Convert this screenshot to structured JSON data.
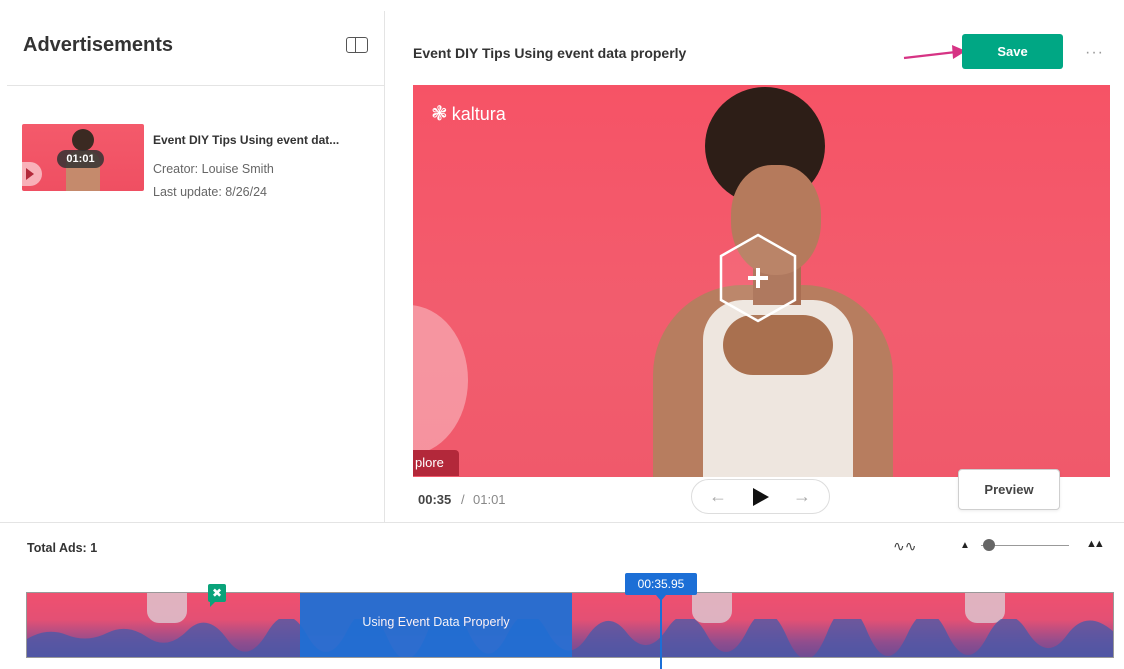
{
  "left_panel": {
    "title": "Advertisements",
    "layout_toggle_icon": "panel-layout-icon",
    "entries": [
      {
        "title": "Event DIY Tips Using event dat...",
        "creator": "Creator: Louise Smith",
        "last_update": "Last update: 8/26/24",
        "duration": "01:01"
      }
    ]
  },
  "editor": {
    "entry_title": "Event DIY Tips Using event data properly",
    "save_label": "Save",
    "more_icon": "more-horizontal-icon",
    "annotation_color": "#d63384",
    "save_color": "#00a784"
  },
  "player": {
    "brand": "kaltura",
    "overlay_chip": "plore",
    "current_time": "00:35",
    "separator": "/",
    "total_time": "01:01",
    "prev_icon": "arrow-left-icon",
    "play_icon": "play-icon",
    "next_icon": "arrow-right-icon",
    "hotspot_icon": "hexagon-plus-icon",
    "preview_label": "Preview"
  },
  "timeline": {
    "total_ads": "Total Ads: 1",
    "waveform_icon": "waveform-icon",
    "zoom_out_icon": "zoom-out-icon",
    "zoom_in_icon": "zoom-in-icon",
    "zoom_level": 0.05,
    "ad_segment_label": "Using Event Data Properly",
    "ad_color": "#1c6fd6",
    "playhead_time": "00:35.95",
    "ad_marker_icon": "ad-marker-icon"
  }
}
